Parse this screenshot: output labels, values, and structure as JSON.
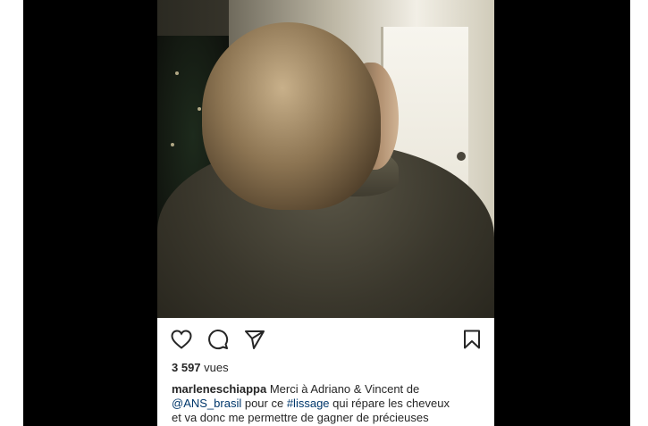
{
  "post": {
    "views_count": "3 597",
    "views_label": "vues",
    "username": "marleneschiappa",
    "caption_part1": " Merci à Adriano & Vincent de",
    "mention": "@ANS_brasil",
    "caption_part2": " pour ce ",
    "hashtag": "#lissage",
    "caption_part3": " qui répare les cheveux",
    "caption_line3": "et va donc me permettre de gagner de précieuses"
  },
  "actions": {
    "like_icon": "heart-icon",
    "comment_icon": "comment-icon",
    "share_icon": "paper-plane-icon",
    "save_icon": "bookmark-icon"
  },
  "colors": {
    "frame_background": "#000000",
    "panel_background": "#ffffff",
    "text_primary": "#262626",
    "link_color": "#00376b"
  }
}
